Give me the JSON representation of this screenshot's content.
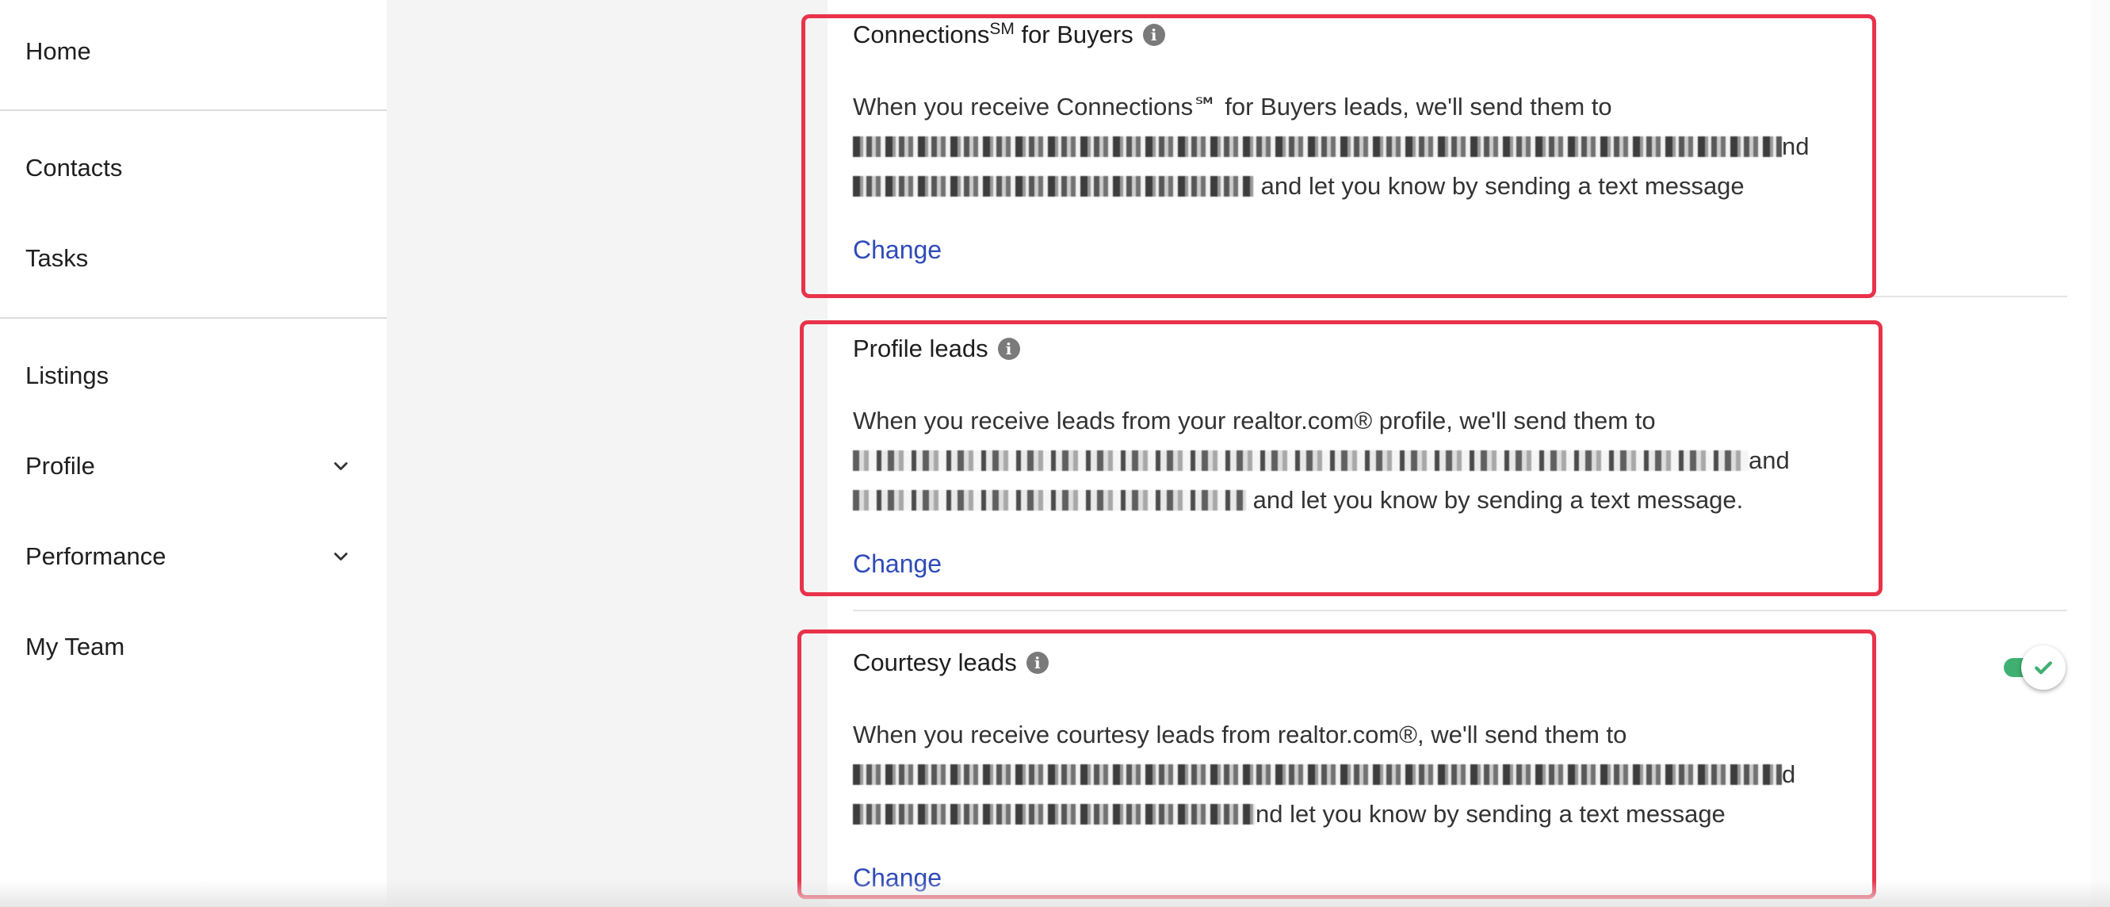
{
  "sidebar": {
    "items": [
      {
        "label": "Home"
      },
      {
        "label": "Contacts"
      },
      {
        "label": "Tasks"
      },
      {
        "label": "Listings"
      },
      {
        "label": "Profile",
        "icon": "chevron-down-icon"
      },
      {
        "label": "Performance",
        "icon": "chevron-down-icon"
      },
      {
        "label": "My Team"
      }
    ]
  },
  "sections": [
    {
      "title_main": "Connections",
      "title_sup": "SM",
      "title_rest": " for Buyers",
      "desc_line1": "When you receive Connections℠ for Buyers leads, we'll send them to",
      "desc_line2_tail": "nd",
      "desc_line3_tail": "and let you know by sending a text message",
      "change_label": "Change"
    },
    {
      "title": "Profile leads",
      "desc_line1": "When you receive leads from your realtor.com® profile, we'll send them to",
      "desc_line2_tail": "and",
      "desc_line3_tail": "and let you know by sending a text message.",
      "change_label": "Change"
    },
    {
      "title": "Courtesy leads",
      "desc_line1": "When you receive courtesy leads from realtor.com®, we'll send them to",
      "desc_line2_tail": "d",
      "desc_line3_tail": "nd let you know by sending a text message",
      "change_label": "Change",
      "toggle_on": true
    }
  ],
  "colors": {
    "highlight": "#e8334a",
    "link": "#2f4bb8",
    "toggle": "#3fb071",
    "info_icon": "#7a7a7a"
  }
}
